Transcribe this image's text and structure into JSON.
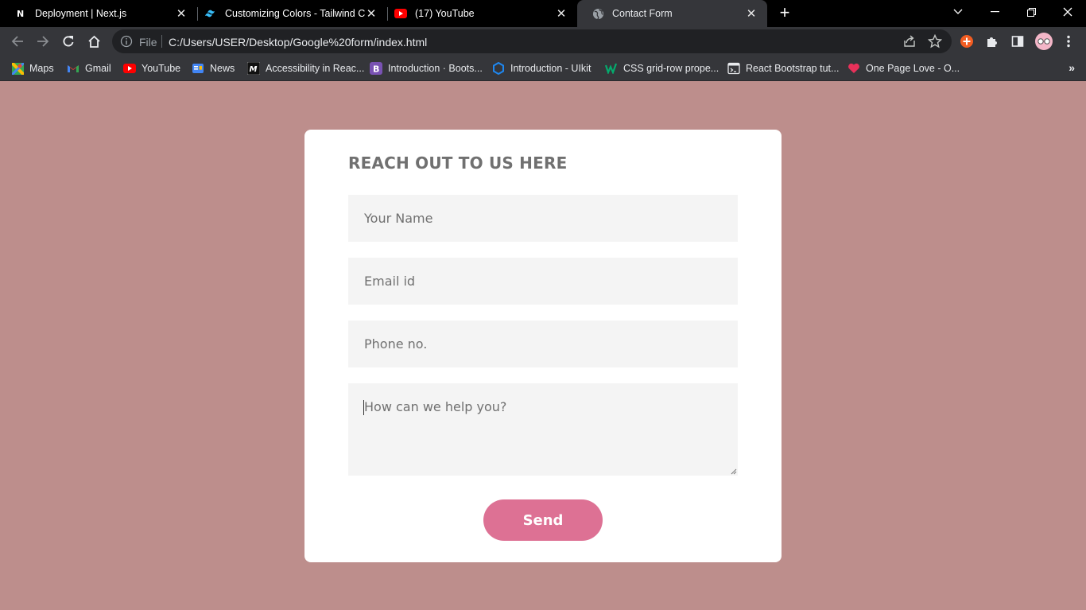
{
  "tabs": [
    {
      "title": "Deployment | Next.js",
      "icon": "nextjs-icon"
    },
    {
      "title": "Customizing Colors - Tailwind CSS",
      "icon": "tailwind-icon"
    },
    {
      "title": "(17) YouTube",
      "icon": "youtube-icon"
    },
    {
      "title": "Contact Form",
      "icon": "globe-icon",
      "active": true
    }
  ],
  "address_bar": {
    "scheme_label": "File",
    "url": "C:/Users/USER/Desktop/Google%20form/index.html"
  },
  "bookmarks": [
    {
      "label": "Maps",
      "icon": "maps-icon"
    },
    {
      "label": "Gmail",
      "icon": "gmail-icon"
    },
    {
      "label": "YouTube",
      "icon": "youtube-icon"
    },
    {
      "label": "News",
      "icon": "news-icon"
    },
    {
      "label": "Accessibility in Reac...",
      "icon": "medium-icon"
    },
    {
      "label": "Introduction · Boots...",
      "icon": "bootstrap-icon"
    },
    {
      "label": "Introduction - UIkit",
      "icon": "uikit-icon"
    },
    {
      "label": "CSS grid-row prope...",
      "icon": "w3schools-icon"
    },
    {
      "label": "React Bootstrap tut...",
      "icon": "terminal-icon"
    },
    {
      "label": "One Page Love - O...",
      "icon": "heart-icon"
    }
  ],
  "form": {
    "heading": "REACH OUT TO US HERE",
    "name_placeholder": "Your Name",
    "email_placeholder": "Email id",
    "phone_placeholder": "Phone no.",
    "message_placeholder": "How can we help you?",
    "send_label": "Send"
  },
  "colors": {
    "page_background": "#bd8e8c",
    "card_background": "#ffffff",
    "field_background": "#f4f4f4",
    "button": "#dd7194",
    "heading_text": "#707070"
  }
}
